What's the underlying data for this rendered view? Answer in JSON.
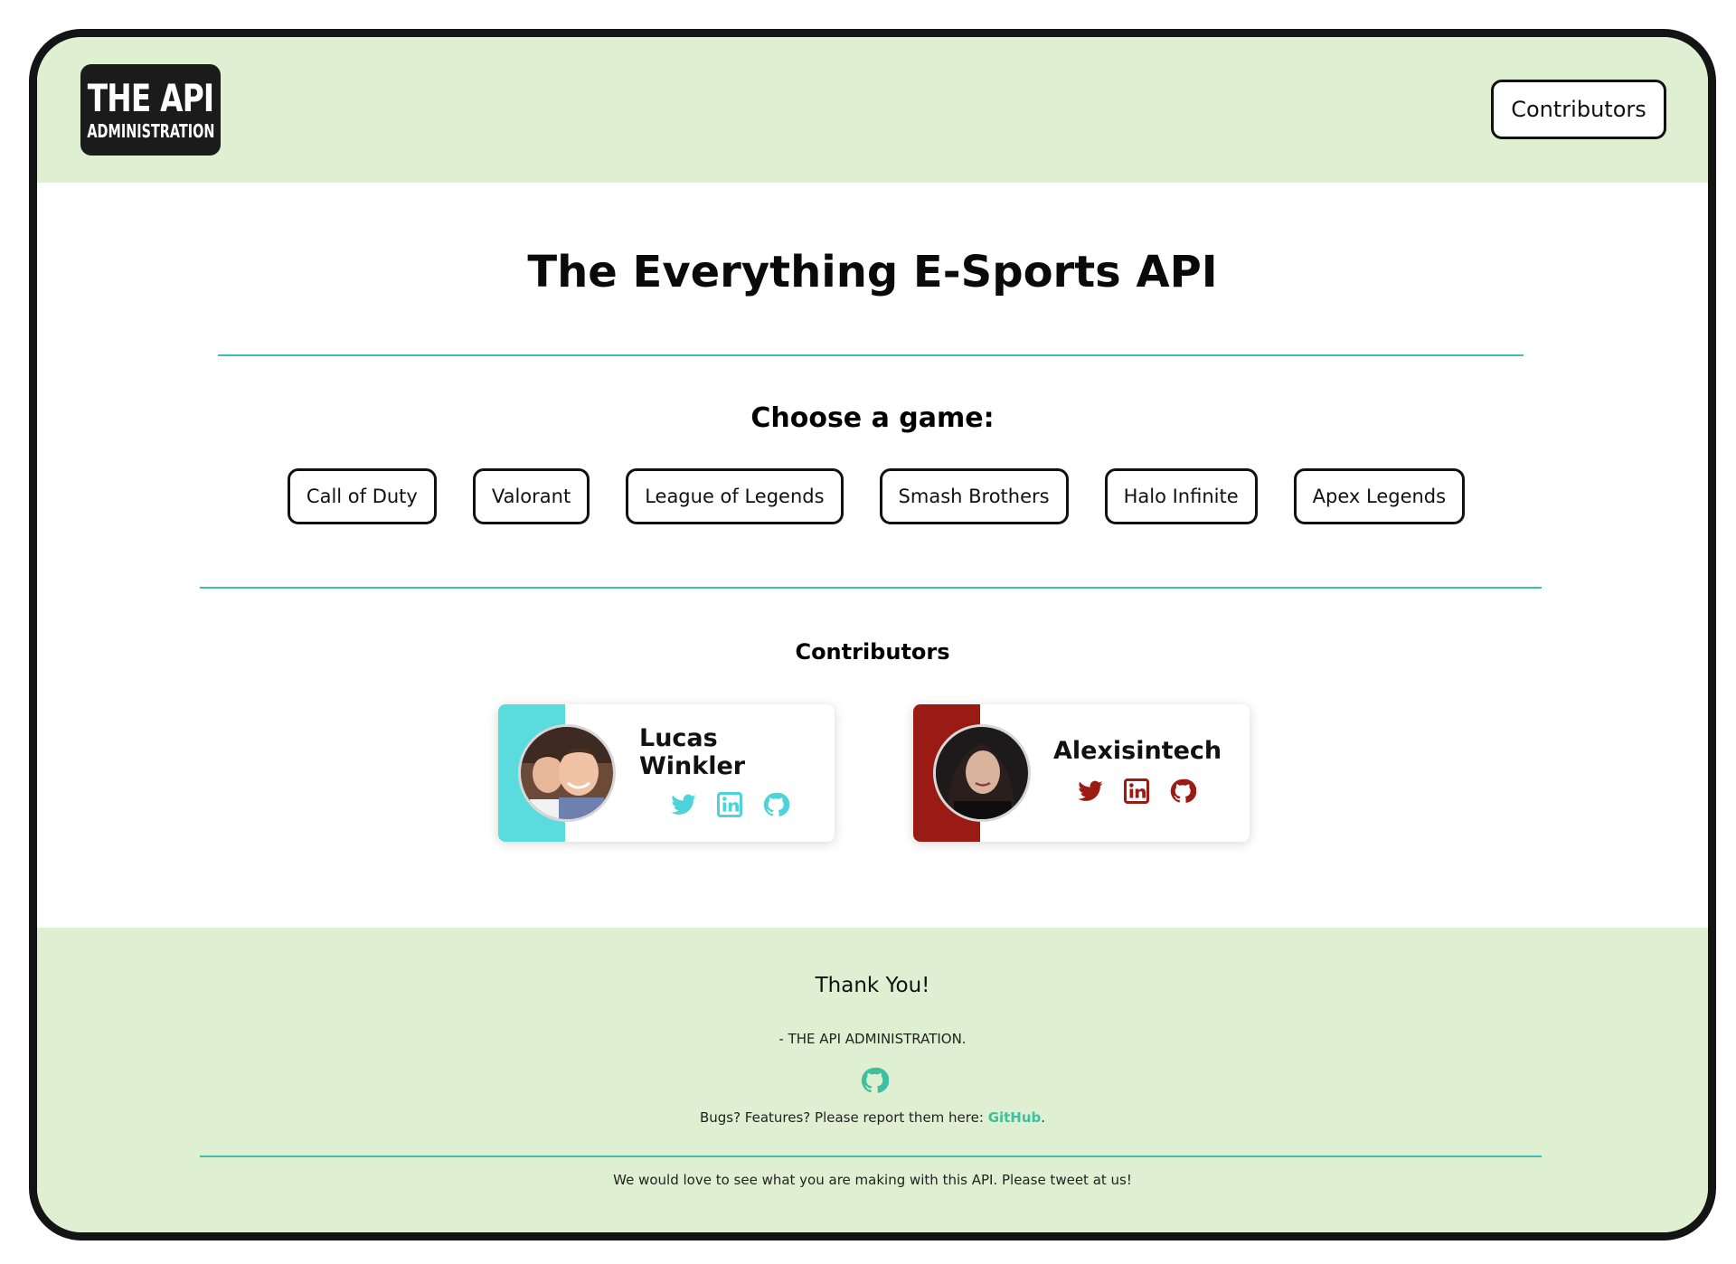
{
  "header": {
    "logo_title": "THE API",
    "logo_subtitle": "ADMINISTRATION",
    "nav_contributors_label": "Contributors"
  },
  "main": {
    "title": "The Everything E-Sports API",
    "choose_heading": "Choose a game:",
    "games": [
      "Call of Duty",
      "Valorant",
      "League of Legends",
      "Smash Brothers",
      "Halo Infinite",
      "Apex Legends"
    ],
    "contributors_heading": "Contributors",
    "contributors": [
      {
        "name": "Lucas Winkler",
        "accent": "#5adbdd",
        "icons": [
          "twitter-icon",
          "linkedin-icon",
          "github-icon"
        ]
      },
      {
        "name": "Alexisintech",
        "accent": "#9a1a14",
        "icons": [
          "twitter-icon",
          "linkedin-icon",
          "github-icon"
        ]
      }
    ]
  },
  "footer": {
    "thanks": "Thank You!",
    "signoff": "- THE API ADMINISTRATION.",
    "bugs_text": "Bugs? Features? Please report them here: ",
    "bugs_link": "GitHub",
    "bugs_end": ".",
    "tweet_text": "We would love to see what you are making with this API. Please tweet at us!"
  },
  "colors": {
    "header_bg": "#dff0d2",
    "rule": "#3dbfb0",
    "link": "#3dbfa0",
    "frame": "#141414"
  }
}
